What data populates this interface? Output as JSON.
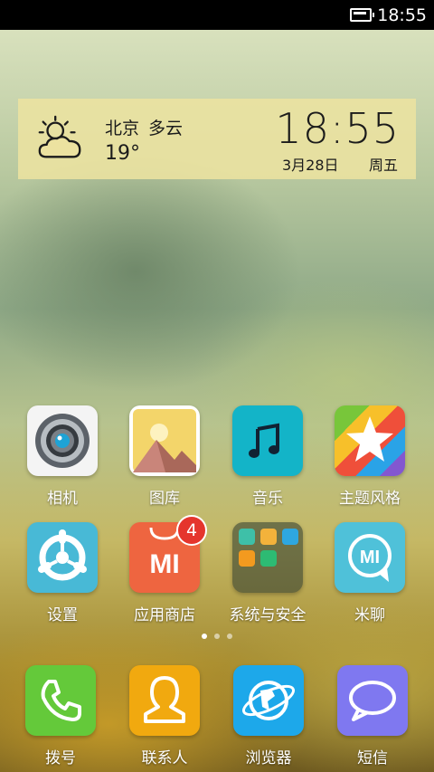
{
  "status_bar": {
    "time": "18:55",
    "battery_icon": "battery-icon"
  },
  "widget": {
    "city": "北京",
    "condition": "多云",
    "temperature": "19°",
    "time": "18:55",
    "date": "3月28日",
    "weekday": "周五",
    "weather_icon": "partly-cloudy-icon"
  },
  "apps": [
    {
      "label": "相机",
      "icon": "camera-icon"
    },
    {
      "label": "图库",
      "icon": "gallery-icon"
    },
    {
      "label": "音乐",
      "icon": "music-icon"
    },
    {
      "label": "主题风格",
      "icon": "theme-icon"
    },
    {
      "label": "设置",
      "icon": "settings-icon"
    },
    {
      "label": "应用商店",
      "icon": "app-store-icon",
      "badge": "4",
      "icon_text": "MI"
    },
    {
      "label": "系统与安全",
      "icon": "folder-icon"
    },
    {
      "label": "米聊",
      "icon": "miliao-icon",
      "icon_text": "MI"
    }
  ],
  "page_indicator": {
    "count": 3,
    "active": 0
  },
  "dock": [
    {
      "label": "拨号",
      "icon": "phone-icon"
    },
    {
      "label": "联系人",
      "icon": "contacts-icon"
    },
    {
      "label": "浏览器",
      "icon": "browser-icon"
    },
    {
      "label": "短信",
      "icon": "messages-icon"
    }
  ],
  "colors": {
    "camera": "#f4f4f4",
    "music": "#13b4c8",
    "settings": "#48b9d6",
    "app_store": "#ee6540",
    "miliao": "#4fc1d9",
    "phone": "#64c93a",
    "contacts": "#f1a90f",
    "browser": "#1da8ea",
    "messages": "#7f78f0"
  }
}
